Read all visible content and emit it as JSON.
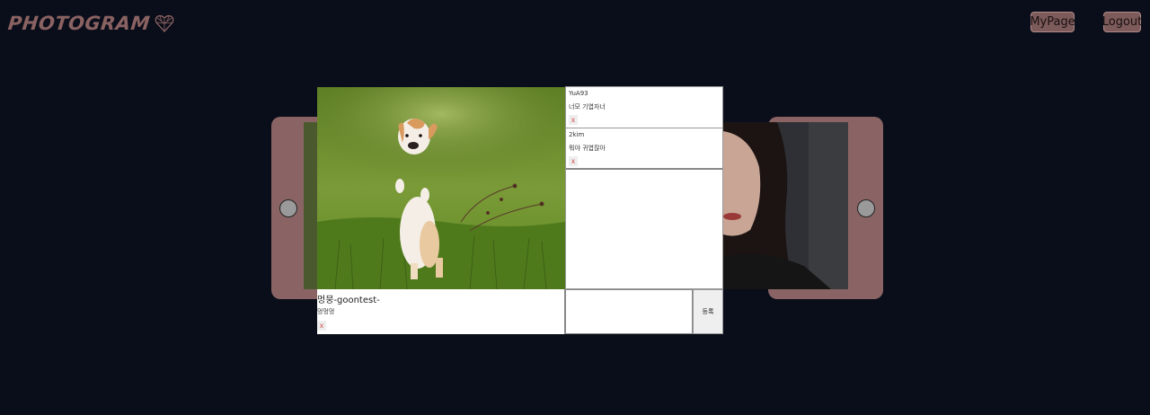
{
  "header": {
    "logo_text": "PHOTOGRAM",
    "mypage_label": "MyPage",
    "logout_label": "Logout"
  },
  "colors": {
    "background": "#0a0e1a",
    "accent": "#8a6464",
    "delete_x": "#d04040"
  },
  "modal": {
    "comments": [
      {
        "user": "YuA93",
        "text": "너모 기엽자너",
        "delete_label": "x"
      },
      {
        "user": "2kim",
        "text": "뭐야 귀엽잖아",
        "delete_label": "x"
      }
    ],
    "post": {
      "user": "멍뭉-goontest-",
      "caption": "멍멍멍",
      "delete_label": "x"
    },
    "comment_input": {
      "value": "",
      "placeholder": ""
    },
    "submit_label": "등록"
  },
  "icons": [
    "heart-logo-icon",
    "phone-home-button-icon"
  ]
}
